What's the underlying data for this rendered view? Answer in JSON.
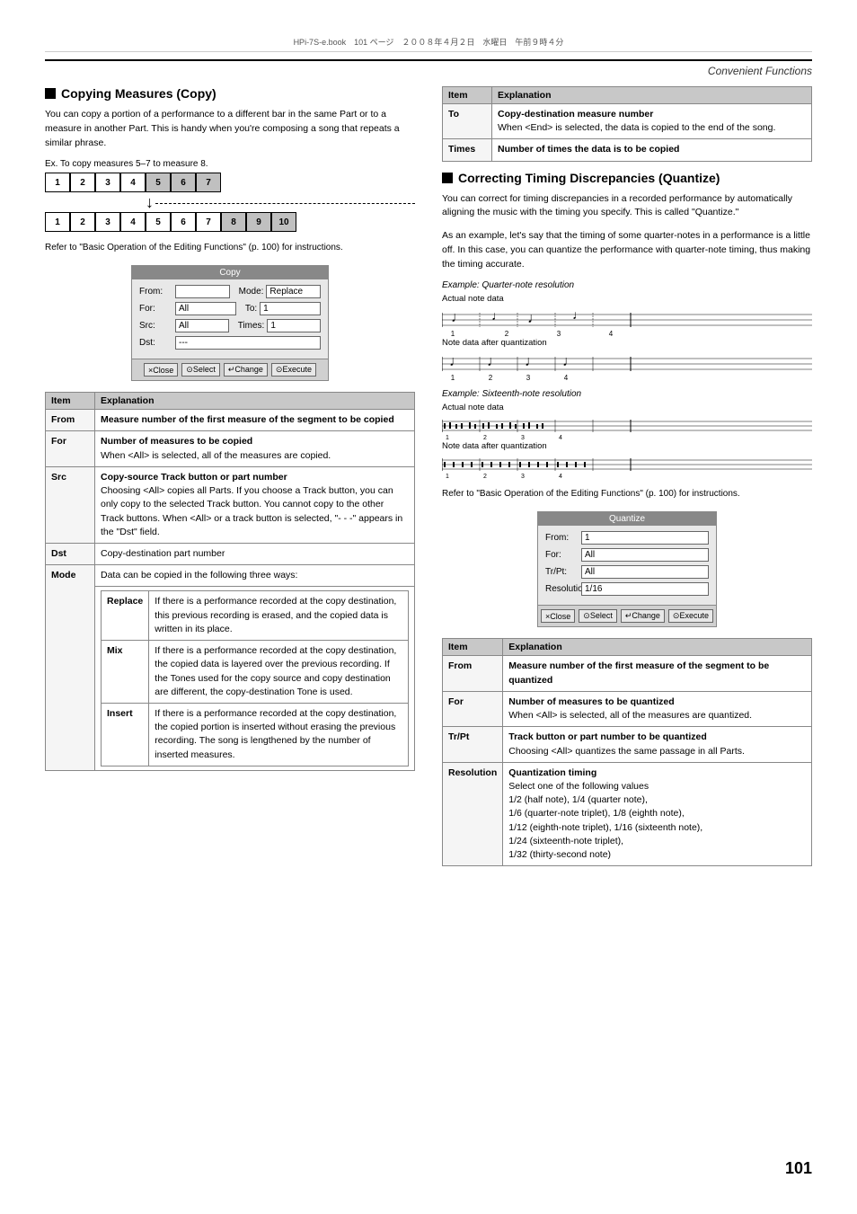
{
  "page": {
    "number": "101",
    "header_text": "Convenient Functions",
    "top_info": "HPi-7S-e.book　101 ページ　２００８年４月２日　水曜日　午前９時４分"
  },
  "left_column": {
    "section_title": "Copying Measures (Copy)",
    "section_desc": "You can copy a portion of a performance to a different bar in the same Part or to a measure in another Part. This is handy when you're composing a song that repeats a similar phrase.",
    "example_label": "Ex. To copy measures 5–7 to measure 8.",
    "measures_row1": [
      "1",
      "2",
      "3",
      "4",
      "5",
      "6",
      "7"
    ],
    "measures_row2": [
      "1",
      "2",
      "3",
      "4",
      "5",
      "6",
      "7",
      "8",
      "9",
      "10"
    ],
    "highlighted_cells_row1": [
      4,
      5,
      6
    ],
    "highlighted_cells_row2": [
      7,
      8,
      9
    ],
    "refer_text": "Refer to \"Basic Operation of the Editing Functions\" (p. 100) for instructions.",
    "dialog": {
      "title": "Copy",
      "fields": [
        {
          "label": "From:",
          "value": "",
          "extra_label": "Mode:",
          "extra_value": "Replace"
        },
        {
          "label": "For:",
          "value": "All",
          "extra_label": "To:",
          "extra_value": "1"
        },
        {
          "label": "Src:",
          "value": "All",
          "extra_label": "Times:",
          "extra_value": "1"
        },
        {
          "label": "Dst:",
          "value": "---"
        }
      ],
      "buttons": [
        "×Close",
        "⊙Select",
        "↵Change",
        "⊙Execute"
      ]
    },
    "table_headers": [
      "Item",
      "Explanation"
    ],
    "table_rows": [
      {
        "item": "From",
        "explanation": "Measure number of the first measure of the segment to be copied",
        "bold": true,
        "sub_rows": []
      },
      {
        "item": "For",
        "explanation_bold": "Number of measures to be copied",
        "explanation_normal": "When <All> is selected, all of the measures are copied.",
        "sub_rows": []
      },
      {
        "item": "Src",
        "explanation_bold": "Copy-source Track button or part number",
        "explanation_normal": "Choosing <All> copies all Parts. If you choose a Track button, you can only copy to the selected Track button. You cannot copy to the other Track buttons. When <All> or a track button is selected, \"- - -\" appears in the \"Dst\" field.",
        "sub_rows": []
      },
      {
        "item": "Dst",
        "explanation_normal": "Copy-destination part number",
        "sub_rows": []
      },
      {
        "item": "Mode",
        "explanation_normal": "Data can be copied in the following three ways:",
        "sub_rows": [
          {
            "sub_item": "Replace",
            "text": "If there is a performance recorded at the copy destination, this previous recording is erased, and the copied data is written in its place."
          },
          {
            "sub_item": "Mix",
            "text": "If there is a performance recorded at the copy destination, the copied data is layered over the previous recording. If the Tones used for the copy source and copy destination are different, the copy-destination Tone is used."
          },
          {
            "sub_item": "Insert",
            "text": "If there is a performance recorded at the copy destination, the copied portion is inserted without erasing the previous recording. The song is lengthened by the number of inserted measures."
          }
        ]
      }
    ]
  },
  "right_column": {
    "top_table_headers": [
      "Item",
      "Explanation"
    ],
    "top_table_rows": [
      {
        "item": "To",
        "explanation_bold": "Copy-destination measure number",
        "explanation_normal": "When <End> is selected, the data is copied to the end of the song."
      },
      {
        "item": "Times",
        "explanation_bold": "Number of times the data is to be copied"
      }
    ],
    "section_title": "Correcting Timing Discrepancies (Quantize)",
    "section_desc1": "You can correct for timing discrepancies in a recorded performance by automatically aligning the music with the timing you specify. This is called \"Quantize.\"",
    "section_desc2": "As an example, let's say that the timing of some quarter-notes in a performance is a little off. In this case, you can quantize the performance with quarter-note timing, thus making the timing accurate.",
    "example1_label": "Example: Quarter-note resolution",
    "actual_note_label": "Actual note data",
    "quantized_note_label": "Note data after quantization",
    "example2_label": "Example: Sixteenth-note resolution",
    "actual_note_label2": "Actual note data",
    "quantized_note_label2": "Note data after quantization",
    "refer_text": "Refer to \"Basic Operation of the Editing Functions\" (p. 100) for instructions.",
    "quantize_dialog": {
      "title": "Quantize",
      "fields": [
        {
          "label": "From:",
          "value": "1"
        },
        {
          "label": "For:",
          "value": "All"
        },
        {
          "label": "Tr/Pt:",
          "value": "All"
        },
        {
          "label": "Resolution:",
          "value": "1/16"
        }
      ],
      "buttons": [
        "×Close",
        "⊙Select",
        "↵Change",
        "⊙Execute"
      ]
    },
    "table2_headers": [
      "Item",
      "Explanation"
    ],
    "table2_rows": [
      {
        "item": "From",
        "explanation_bold": "Measure number of the first measure of the segment to be quantized"
      },
      {
        "item": "For",
        "explanation_bold": "Number of measures to be quantized",
        "explanation_normal": "When <All> is selected, all of the measures are quantized."
      },
      {
        "item": "Tr/Pt",
        "explanation_bold": "Track button or part number to be quantized",
        "explanation_normal": "Choosing <All> quantizes the same passage in all Parts."
      },
      {
        "item": "Resolution",
        "explanation_bold": "Quantization timing",
        "explanation_normal": "Select one of the following values\n1/2 (half note), 1/4 (quarter note),\n1/6 (quarter-note triplet), 1/8 (eighth note),\n1/12 (eighth-note triplet), 1/16 (sixteenth note),\n1/24 (sixteenth-note triplet),\n1/32 (thirty-second note)"
      }
    ]
  }
}
